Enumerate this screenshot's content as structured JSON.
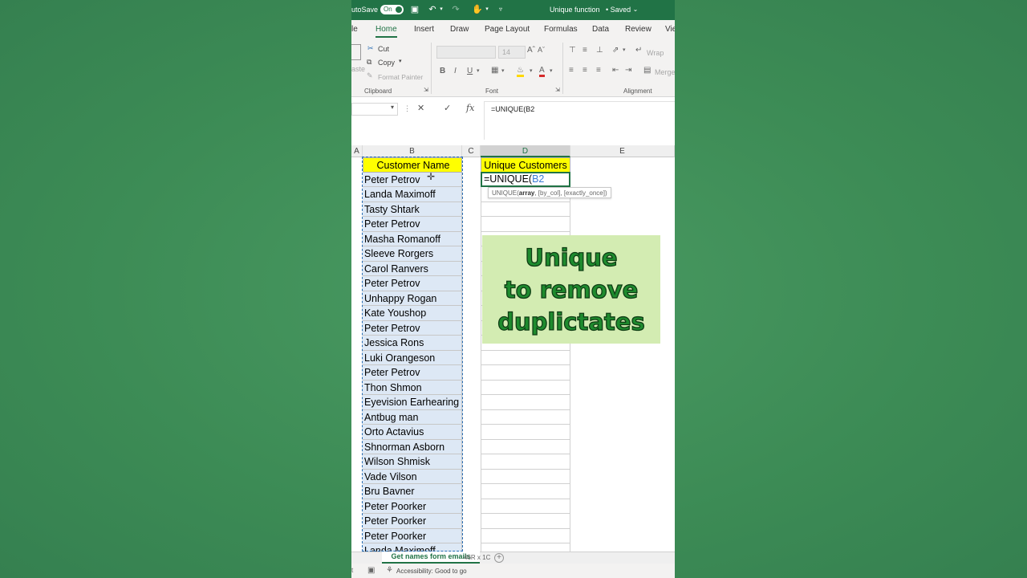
{
  "titlebar": {
    "autosave_label": "utoSave",
    "autosave_state": "On",
    "doc_title": "Unique function",
    "saved_status": "• Saved"
  },
  "tabs": [
    {
      "label": "le"
    },
    {
      "label": "Home"
    },
    {
      "label": "Insert"
    },
    {
      "label": "Draw"
    },
    {
      "label": "Page Layout"
    },
    {
      "label": "Formulas"
    },
    {
      "label": "Data"
    },
    {
      "label": "Review"
    },
    {
      "label": "Vie"
    }
  ],
  "ribbon": {
    "paste_label": "aste",
    "cut_label": "Cut",
    "copy_label": "Copy",
    "format_painter_label": "Format Painter",
    "clipboard_group": "Clipboard",
    "font_size": "14",
    "font_group": "Font",
    "bold": "B",
    "italic": "I",
    "underline": "U",
    "wrap_label": "Wrap",
    "merge_label": "Merge",
    "alignment_group": "Alignment"
  },
  "formula_bar": {
    "formula": "=UNIQUE(B2"
  },
  "columns": [
    "A",
    "B",
    "C",
    "D",
    "E"
  ],
  "sheet": {
    "header_b": "Customer Name",
    "header_d": "Unique Customers",
    "formula_cell_prefix": "=UNIQUE(",
    "formula_cell_ref": "B2",
    "tooltip_fn": "UNIQUE(",
    "tooltip_bold": "array",
    "tooltip_rest": ", [by_col], [exactly_once])",
    "customers": [
      "Peter Petrov",
      "Landa Maximoff",
      "Tasty Shtark",
      "Peter Petrov",
      "Masha Romanoff",
      "Sleeve Rorgers",
      "Carol Ranvers",
      "Peter Petrov",
      "Unhappy Rogan",
      "Kate Youshop",
      "Peter Petrov",
      "Jessica Rons",
      "Luki Orangeson",
      "Peter Petrov",
      "Thon Shmon",
      "Eyevision Earhearing",
      "Antbug man",
      "Orto Actavius",
      "Shnorman Asborn",
      "Wilson Shmisk",
      "Vade Vilson",
      "Bru Bavner",
      "Peter Poorker",
      "Peter Poorker",
      "Peter Poorker",
      "Landa Maximoff"
    ]
  },
  "overlay": {
    "line1": "Unique",
    "line2": "to remove",
    "line3": "duplictates"
  },
  "bottom": {
    "sheet_tab": "Get names form emails",
    "selection_count": "46R x 1C",
    "accessibility": "Accessibility: Good to go",
    "add_sheet": "+"
  },
  "colors": {
    "accent": "#217346",
    "header_fill": "#ffff00",
    "overlay_fill": "#d3ecb2",
    "overlay_text": "#1e8b2e",
    "background": "#3f8f57"
  }
}
